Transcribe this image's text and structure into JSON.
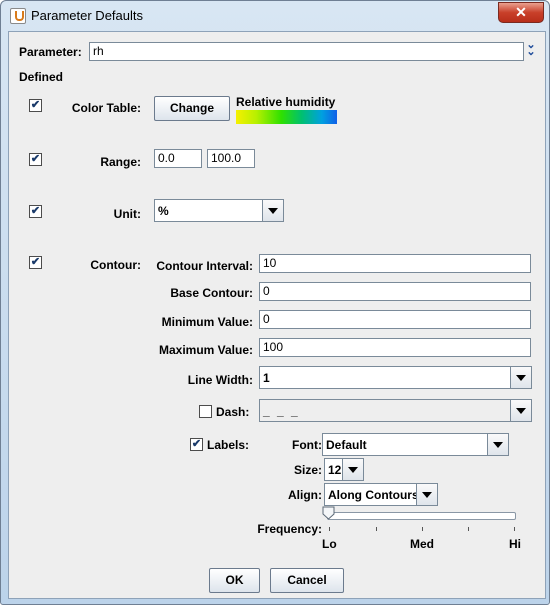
{
  "window": {
    "title": "Parameter Defaults",
    "close_glyph": "✕"
  },
  "parameter": {
    "label": "Parameter:",
    "value": "rh"
  },
  "defined_label": "Defined",
  "check_glyph": "✔",
  "color_table": {
    "label": "Color Table:",
    "change_label": "Change",
    "name": "Relative humidity",
    "checked": true
  },
  "range": {
    "label": "Range:",
    "min": "0.0",
    "max": "100.0",
    "checked": true
  },
  "unit": {
    "label": "Unit:",
    "value": "%",
    "checked": true
  },
  "contour": {
    "label": "Contour:",
    "checked": true,
    "interval_label": "Contour Interval:",
    "interval": "10",
    "base_label": "Base Contour:",
    "base": "0",
    "min_label": "Minimum Value:",
    "min": "0",
    "max_label": "Maximum Value:",
    "max": "100",
    "line_width_label": "Line Width:",
    "line_width": "1",
    "dash_label": "Dash:",
    "dash_value": "_ _ _",
    "dash_checked": false,
    "labels_label": "Labels:",
    "labels_checked": true,
    "font_label": "Font:",
    "font_value": "Default",
    "size_label": "Size:",
    "size_value": "12",
    "align_label": "Align:",
    "align_value": "Along Contours",
    "frequency_label": "Frequency:",
    "frequency_lo": "Lo",
    "frequency_med": "Med",
    "frequency_hi": "Hi",
    "frequency_value": 0
  },
  "footer": {
    "ok_label": "OK",
    "cancel_label": "Cancel"
  }
}
